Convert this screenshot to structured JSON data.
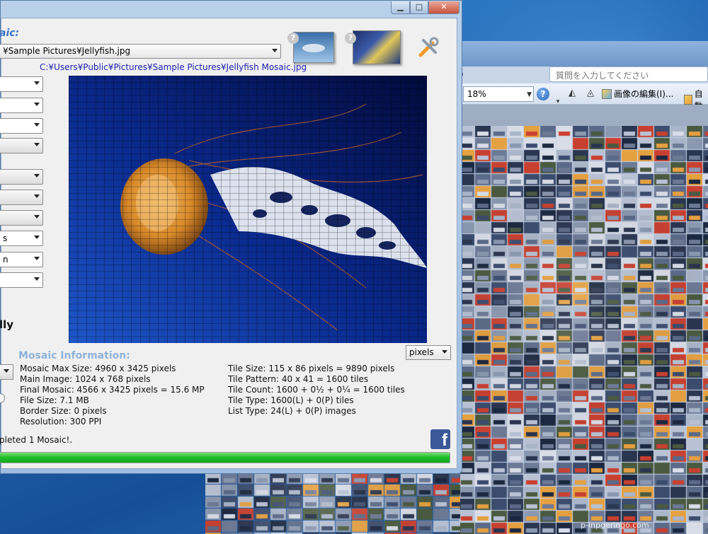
{
  "app": {
    "title_fragment": "aic:",
    "main_image_path": "¥Sample Pictures¥Jellyfish.jpg",
    "output_path": "C:¥Users¥Public¥Pictures¥Sample Pictures¥Jellyfish Mosaic.jpg",
    "help_1": "?",
    "help_2": "?",
    "combo_fragment_s": "s",
    "combo_fragment_n": "n",
    "bold_fragment": "lly",
    "units": "pixels",
    "info_title": "Mosaic Information:",
    "info_left": [
      "Mosaic Max Size: 4960 x 3425 pixels",
      "Main Image: 1024 x 768 pixels",
      "Final Mosaic: 4566 x 3425 pixels = 15.6 MP",
      "File Size: 7.1 MB",
      "Border Size: 0 pixels",
      "Resolution: 300 PPI"
    ],
    "info_right": [
      "Tile Size: 115 x 86 pixels = 9890 pixels",
      "Tile Pattern: 40 x 41 = 1600 tiles",
      "Tile Count: 1600 + 0½ + 0¼ = 1600 tiles",
      "Tile Type: 1600(L) + 0(P) tiles",
      "List Type: 24(L) + 0(P) images"
    ],
    "status": "pleted 1 Mosaic!.",
    "facebook": "f",
    "progress_fraction": 1.0
  },
  "word": {
    "menu_fragment": ")",
    "help_placeholder": "質問を入力してください",
    "zoom": "18%",
    "edit_image": "画像の編集(I)...",
    "auto": "自動"
  },
  "watermark": "p-inpgeringo.com",
  "colors": {
    "accent": "#3b76c8",
    "link": "#1f1fb0",
    "progress": "#1fbf2a",
    "facebook": "#3b5998"
  }
}
